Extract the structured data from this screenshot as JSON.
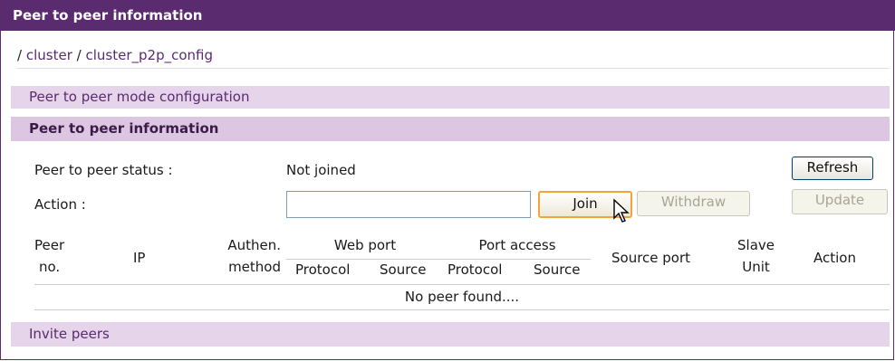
{
  "window": {
    "title": "Peer to peer information"
  },
  "breadcrumb": {
    "sep": "/",
    "items": [
      "cluster",
      "cluster_p2p_config"
    ]
  },
  "sections": {
    "mode_config": "Peer to peer mode configuration",
    "info": "Peer to peer information",
    "invite": "Invite peers"
  },
  "status": {
    "label": "Peer to peer status :",
    "value": "Not joined"
  },
  "action": {
    "label": "Action :",
    "value": "",
    "placeholder": ""
  },
  "buttons": {
    "refresh": "Refresh",
    "join": "Join",
    "withdraw": "Withdraw",
    "update": "Update"
  },
  "table": {
    "headers": {
      "peer_no_1": "Peer",
      "peer_no_2": "no.",
      "ip": "IP",
      "auth_1": "Authen.",
      "auth_2": "method",
      "web_port": "Web port",
      "port_access": "Port access",
      "protocol": "Protocol",
      "source": "Source",
      "source_port": "Source port",
      "slave_1": "Slave",
      "slave_2": "Unit",
      "action": "Action"
    },
    "empty_message": "No peer found...."
  }
}
